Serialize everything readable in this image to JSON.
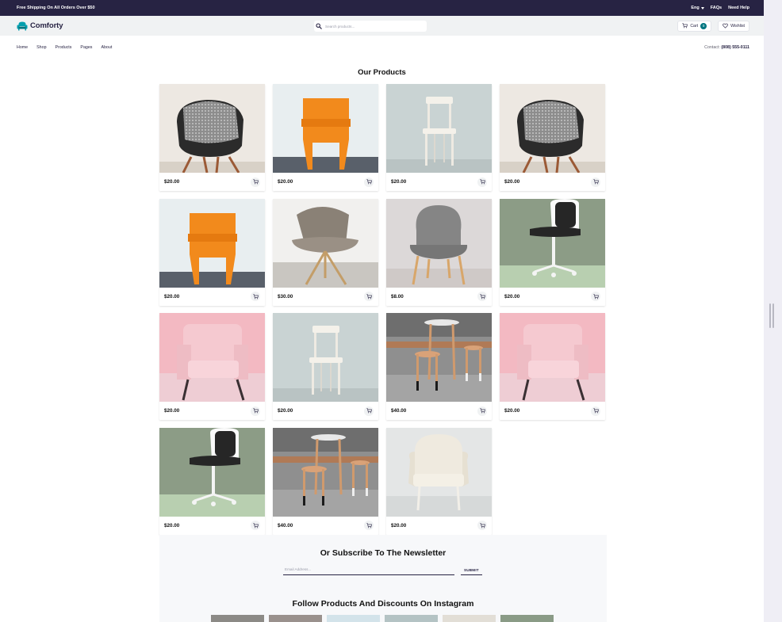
{
  "topbar": {
    "promo": "Free Shipping On All Orders Over $50",
    "lang": "Eng",
    "faqs": "FAQs",
    "help": "Need Help"
  },
  "header": {
    "brand": "Comforty",
    "search_placeholder": "Search products...",
    "cart_label": "Cart",
    "cart_count": "0",
    "wishlist_label": "Wishlist"
  },
  "nav": {
    "links": [
      "Home",
      "Shop",
      "Products",
      "Pages",
      "About"
    ],
    "contact_label": "Contact:",
    "contact_phone": "(808) 555-0111"
  },
  "products": {
    "title": "Our Products",
    "items": [
      {
        "price": "$20.00",
        "image": "black-eames-chair-with-pillow"
      },
      {
        "price": "$20.00",
        "image": "orange-chair"
      },
      {
        "price": "$20.00",
        "image": "white-wooden-chair"
      },
      {
        "price": "$20.00",
        "image": "black-eames-chair-with-pillow"
      },
      {
        "price": "$20.00",
        "image": "orange-chair"
      },
      {
        "price": "$30.00",
        "image": "grey-lounge-chair"
      },
      {
        "price": "$8.00",
        "image": "grey-wingback-chair"
      },
      {
        "price": "$20.00",
        "image": "white-desk-chair"
      },
      {
        "price": "$20.00",
        "image": "pink-armchair"
      },
      {
        "price": "$20.00",
        "image": "white-wooden-chair"
      },
      {
        "price": "$40.00",
        "image": "wooden-stools-set"
      },
      {
        "price": "$20.00",
        "image": "pink-armchair"
      },
      {
        "price": "$20.00",
        "image": "white-desk-chair"
      },
      {
        "price": "$40.00",
        "image": "wooden-stools-set"
      },
      {
        "price": "$20.00",
        "image": "cream-tufted-chair"
      }
    ]
  },
  "newsletter": {
    "title": "Or Subscribe To The Newsletter",
    "email_placeholder": "Email Address...",
    "submit_label": "SUBMIT"
  },
  "instagram": {
    "title": "Follow Products And Discounts On Instagram"
  },
  "colors": {
    "topbar": "#272343",
    "accent": "#007580",
    "header_bg": "#f0f2f3"
  }
}
